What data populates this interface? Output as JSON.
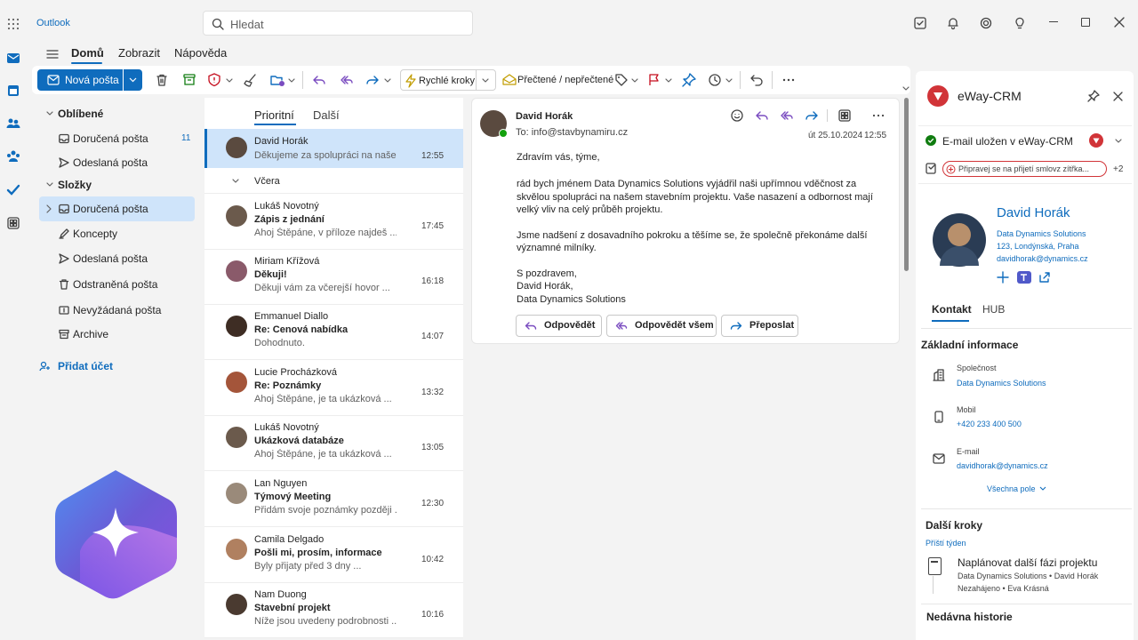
{
  "titlebar": {
    "app_name": "Outlook",
    "search_placeholder": "Hledat"
  },
  "ribbon": {
    "tabs": [
      "Domů",
      "Zobrazit",
      "Nápověda"
    ],
    "new_mail_label": "Nová pošta",
    "quick_steps_label": "Rychlé kroky",
    "read_unread_label": "Přečtené / nepřečtené"
  },
  "folders": {
    "favorites_header": "Oblíbené",
    "favorites": [
      {
        "label": "Doručená pošta",
        "count": "11"
      },
      {
        "label": "Odeslaná pošta",
        "count": ""
      }
    ],
    "folders_header": "Složky",
    "items": [
      {
        "label": "Doručená pošta",
        "selected": true
      },
      {
        "label": "Koncepty"
      },
      {
        "label": "Odeslaná pošta"
      },
      {
        "label": "Odstraněná pošta"
      },
      {
        "label": "Nevyžádaná pošta"
      },
      {
        "label": "Archive"
      }
    ],
    "add_account": "Přidat účet"
  },
  "message_list": {
    "tabs": [
      "Prioritní",
      "Další"
    ],
    "group_yesterday": "Včera",
    "messages": [
      {
        "sender": "David Horák",
        "subject": "",
        "preview": "Děkujeme za spolupráci na našem...",
        "time": "12:55",
        "selected": true,
        "avatar_color": "#5a4a3f"
      },
      {
        "sender": "Lukáš Novotný",
        "subject": "Zápis z jednání",
        "preview": "Ahoj Štěpáne, v příloze najdeš ...",
        "time": "17:45",
        "avatar_color": "#6b5a4c"
      },
      {
        "sender": "Miriam Křížová",
        "subject": "Děkuji!",
        "preview": "Děkuji vám za včerejší hovor ...",
        "time": "16:18",
        "avatar_color": "#8a5a6a"
      },
      {
        "sender": "Emmanuel Diallo",
        "subject": "Re: Cenová nabídka",
        "preview": "Dohodnuto.",
        "time": "14:07",
        "avatar_color": "#3e2d24"
      },
      {
        "sender": "Lucie Procházková",
        "subject": "Re: Poznámky",
        "preview": "Ahoj Štěpáne, je ta ukázková ...",
        "time": "13:32",
        "avatar_color": "#a4553a"
      },
      {
        "sender": "Lukáš Novotný",
        "subject": "Ukázková databáze",
        "preview": "Ahoj Štěpáne, je ta ukázková ...",
        "time": "13:05",
        "avatar_color": "#6b5a4c"
      },
      {
        "sender": "Lan Nguyen",
        "subject": "Týmový Meeting",
        "preview": "Přidám svoje poznámky později ...",
        "time": "12:30",
        "avatar_color": "#9a8a7a"
      },
      {
        "sender": "Camila Delgado",
        "subject": "Pošli mi, prosím, informace",
        "preview": "Byly přijaty před 3 dny ...",
        "time": "10:42",
        "avatar_color": "#b08060"
      },
      {
        "sender": "Nam Duong",
        "subject": "Stavební projekt",
        "preview": "Níže jsou uvedeny podrobnosti ...",
        "time": "10:16",
        "avatar_color": "#4a3a30"
      }
    ]
  },
  "reading_pane": {
    "sender": "David Horák",
    "to": "To: info@stavbynamiru.cz",
    "date": "út 25.10.2024",
    "time": "12:55",
    "greeting": "Zdravím vás, týme,",
    "para1_l1": "rád bych jménem Data Dynamics Solutions vyjádřil naši upřímnou vděčnost za",
    "para1_l2": "skvělou spolupráci na našem stavebním projektu. Vaše nasazení a odbornost mají",
    "para1_l3": "velký vliv na celý průběh projektu.",
    "para2_l1": "Jsme nadšení z dosavadního pokroku a těšíme se, že společně překonáme další",
    "para2_l2": "významné milníky.",
    "sign1": "S pozdravem,",
    "sign2": "David Horák,",
    "sign3": "Data Dynamics Solutions",
    "reply": "Odpovědět",
    "reply_all": "Odpovědět všem",
    "forward": "Přeposlat"
  },
  "eway": {
    "title": "eWay-CRM",
    "saved_status": "E-mail uložen v eWay-CRM",
    "reminder": "Připravej se na přijetí smlovz zítřka...",
    "more_count": "+2",
    "contact_name": "David Horák",
    "company": "Data Dynamics Solutions",
    "address": "123, Londýnská, Praha",
    "email_short": "davidhorak@dynamics.cz",
    "tabs": [
      "Kontakt",
      "HUB"
    ],
    "basic_info": "Základní informace",
    "company_label": "Společnost",
    "company_value": "Data Dynamics Solutions",
    "mobile_label": "Mobil",
    "mobile_value": "+420 233 400 500",
    "email_label": "E-mail",
    "email_value": "davidhorak@dynamics.cz",
    "all_fields": "Všechna pole",
    "next_steps": "Další kroky",
    "next_week": "Příští týden",
    "task_title": "Naplánovat další fázi projektu",
    "task_meta1": "Data Dynamics Solutions • David Horák",
    "task_meta2": "Nezahájeno • Eva Krásná",
    "recent_history": "Nedávna historie"
  }
}
